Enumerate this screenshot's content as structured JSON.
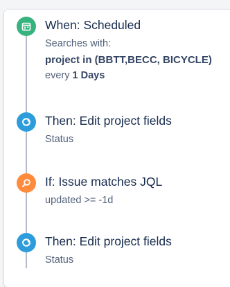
{
  "colors": {
    "trigger": "#36b37e",
    "action": "#2d9cdb",
    "condition": "#ff8b3d",
    "connector": "#b3bac5"
  },
  "steps": [
    {
      "icon": "calendar-icon",
      "title": "When: Scheduled",
      "detail_label": "Searches with:",
      "detail_query": "project in (BBTT,BECC, BICYCLE)",
      "detail_prefix": "every",
      "detail_interval": "1 Days"
    },
    {
      "icon": "edit-arrow-icon",
      "title": "Then: Edit project fields",
      "detail": "Status"
    },
    {
      "icon": "search-icon",
      "title": "If: Issue matches JQL",
      "detail": "updated >= -1d"
    },
    {
      "icon": "edit-arrow-icon",
      "title": "Then: Edit project fields",
      "detail": "Status"
    }
  ]
}
